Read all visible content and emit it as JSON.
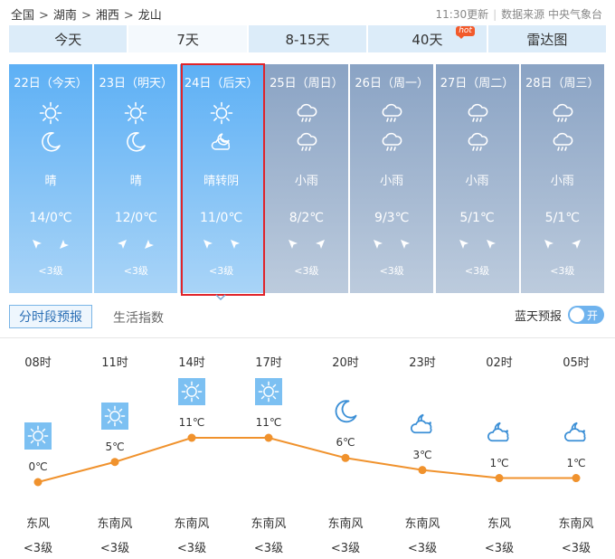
{
  "breadcrumb": [
    "全国",
    "湖南",
    "湘西",
    "龙山"
  ],
  "breadcrumb_sep": ">",
  "update_time": "11:30更新",
  "source": "数据来源 中央气象台",
  "tabs": [
    {
      "label": "今天",
      "active": false
    },
    {
      "label": "7天",
      "active": true
    },
    {
      "label": "8-15天",
      "active": false
    },
    {
      "label": "40天",
      "active": false,
      "badge": "hot"
    },
    {
      "label": "雷达图",
      "active": false
    }
  ],
  "days": [
    {
      "label": "22日（今天）",
      "icon_day": "sun-icon",
      "icon_night": "moon-icon",
      "condition": "晴",
      "temp": "14/0℃",
      "wind_level": "<3级",
      "style": "sunny"
    },
    {
      "label": "23日（明天）",
      "icon_day": "sun-icon",
      "icon_night": "moon-icon",
      "condition": "晴",
      "temp": "12/0℃",
      "wind_level": "<3级",
      "style": "sunny"
    },
    {
      "label": "24日（后天）",
      "icon_day": "sun-icon",
      "icon_night": "cloudy-moon-icon",
      "condition": "晴转阴",
      "temp": "11/0℃",
      "wind_level": "<3级",
      "style": "sunny",
      "selected": true
    },
    {
      "label": "25日（周日）",
      "icon_day": "rain-icon",
      "icon_night": "rain-icon",
      "condition": "小雨",
      "temp": "8/2℃",
      "wind_level": "<3级",
      "style": "rain"
    },
    {
      "label": "26日（周一）",
      "icon_day": "rain-icon",
      "icon_night": "rain-icon",
      "condition": "小雨",
      "temp": "9/3℃",
      "wind_level": "<3级",
      "style": "rain"
    },
    {
      "label": "27日（周二）",
      "icon_day": "rain-icon",
      "icon_night": "rain-icon",
      "condition": "小雨",
      "temp": "5/1℃",
      "wind_level": "<3级",
      "style": "rain"
    },
    {
      "label": "28日（周三）",
      "icon_day": "rain-icon",
      "icon_night": "rain-icon",
      "condition": "小雨",
      "temp": "5/1℃",
      "wind_level": "<3级",
      "style": "rain"
    }
  ],
  "subtabs": {
    "hourly": "分时段预报",
    "life": "生活指数"
  },
  "blue_sky": {
    "label": "蓝天预报",
    "toggle": "开"
  },
  "hourly": [
    {
      "time": "08时",
      "icon": "sun-icon",
      "temp": 0,
      "temp_label": "0℃",
      "wind": "东风",
      "level": "<3级"
    },
    {
      "time": "11时",
      "icon": "sun-icon",
      "temp": 5,
      "temp_label": "5℃",
      "wind": "东南风",
      "level": "<3级"
    },
    {
      "time": "14时",
      "icon": "sun-icon",
      "temp": 11,
      "temp_label": "11℃",
      "wind": "东南风",
      "level": "<3级"
    },
    {
      "time": "17时",
      "icon": "sun-icon",
      "temp": 11,
      "temp_label": "11℃",
      "wind": "东南风",
      "level": "<3级"
    },
    {
      "time": "20时",
      "icon": "moon-icon",
      "temp": 6,
      "temp_label": "6℃",
      "wind": "东南风",
      "level": "<3级"
    },
    {
      "time": "23时",
      "icon": "cloudy-moon-icon",
      "temp": 3,
      "temp_label": "3℃",
      "wind": "东南风",
      "level": "<3级"
    },
    {
      "time": "02时",
      "icon": "cloudy-moon-icon",
      "temp": 1,
      "temp_label": "1℃",
      "wind": "东风",
      "level": "<3级"
    },
    {
      "time": "05时",
      "icon": "cloudy-moon-icon",
      "temp": 1,
      "temp_label": "1℃",
      "wind": "东南风",
      "level": "<3级"
    }
  ],
  "colors": {
    "line": "#f0922d",
    "sunny_card": "#5db0f5",
    "rain_card": "#8aa3c4",
    "selected_border": "#e0242a"
  }
}
